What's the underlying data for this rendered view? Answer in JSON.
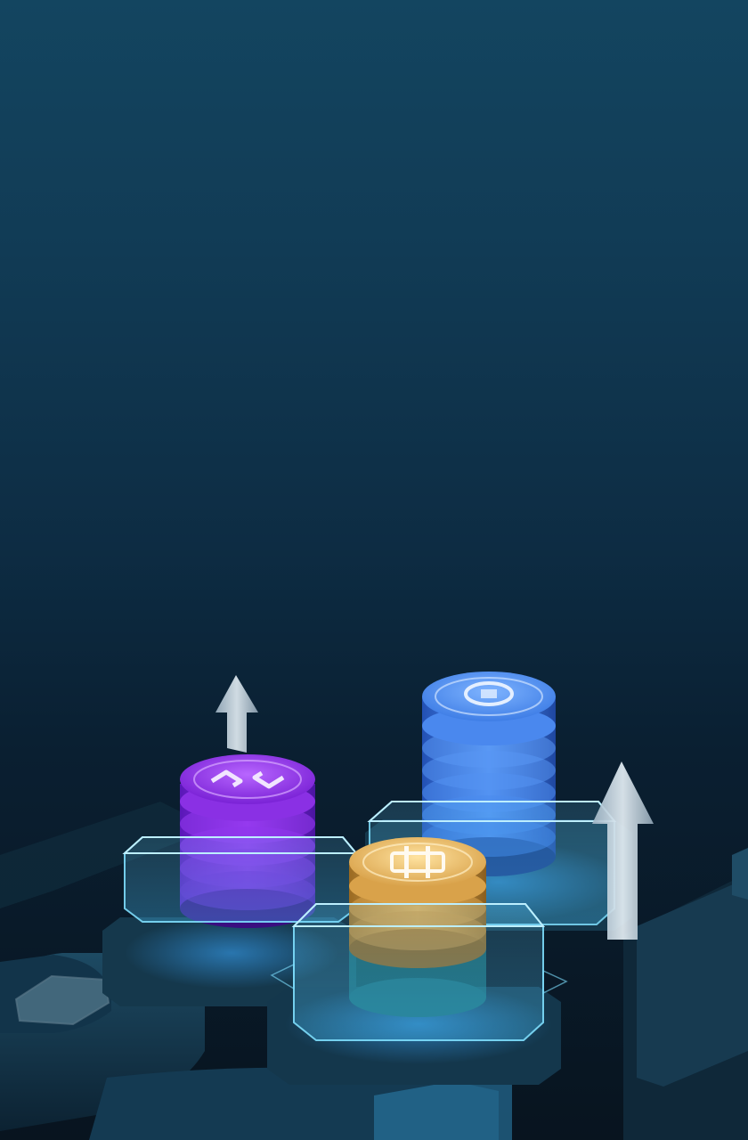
{
  "scene": {
    "description_colors": {
      "bg_top": "#134560",
      "bg_bottom": "#08141f",
      "purple_coin": "#8b2fe0",
      "blue_coin": "#3f7ee6",
      "gold_coin": "#d9a24a",
      "glass_glow": "#49c6ff"
    },
    "coin_stacks": [
      {
        "name": "polygon-coin-stack",
        "symbol_icon": "polygon-icon",
        "coin_count": 5
      },
      {
        "name": "blue-coin-stack",
        "symbol_icon": "currency-icon",
        "coin_count": 8
      },
      {
        "name": "bitcoin-coin-stack",
        "symbol_icon": "bitcoin-icon",
        "coin_count": 4
      }
    ],
    "arrows": [
      "up-arrow-icon",
      "up-arrow-icon"
    ]
  }
}
